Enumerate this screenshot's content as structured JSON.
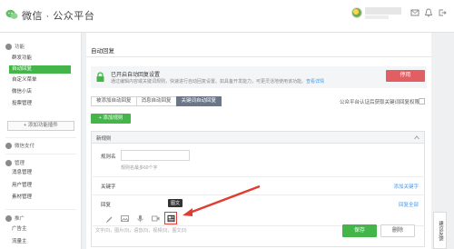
{
  "header": {
    "logo_text": "微信 · 公众平台",
    "user_name": "",
    "icons": [
      "message-icon",
      "bell-icon",
      "logout-icon"
    ]
  },
  "sidebar": {
    "groups": [
      {
        "label": "功能",
        "icon": "function-icon"
      },
      {
        "label": "微信支付",
        "icon": "wechat-pay-icon"
      },
      {
        "label": "管理",
        "icon": "manage-icon"
      },
      {
        "label": "推广",
        "icon": "promote-icon"
      }
    ],
    "items": [
      {
        "label": "群发功能",
        "active": false
      },
      {
        "label": "自动回复",
        "active": true
      },
      {
        "label": "自定义菜单",
        "active": false
      },
      {
        "label": "微信小店",
        "active": false
      },
      {
        "label": "投票管理",
        "active": false
      },
      {
        "label": "消息管理",
        "active": false
      },
      {
        "label": "用户管理",
        "active": false
      },
      {
        "label": "素材管理",
        "active": false
      },
      {
        "label": "广告主",
        "active": false
      },
      {
        "label": "流量主",
        "active": false
      }
    ],
    "add_plugin": "+ 添加功能插件"
  },
  "main": {
    "title": "自动回复",
    "notice": {
      "title": "已开启自动回复设置",
      "desc": "通过编辑内容或关键词规则，快速进行自动回复设置。如具备开发能力，可更灵活地使用该功能。",
      "link": "查看详情"
    },
    "disable_button": "停用",
    "tabs": [
      {
        "label": "被添加自动回复",
        "selected": false
      },
      {
        "label": "消息自动回复",
        "selected": false
      },
      {
        "label": "关键词自动回复",
        "selected": true
      }
    ],
    "kw_check_label": "公众平台认证后获取关键词回复权限",
    "add_rule_button": "+ 添加规则",
    "rule": {
      "header": "新规则",
      "name_label": "规则名",
      "name_hint": "规则名最多60个字",
      "keyword_label": "关键字",
      "add_keyword": "添加关键字",
      "reply_label": "回复",
      "reply_all": "回复全部",
      "toolbar": [
        "text-icon",
        "image-icon",
        "voice-icon",
        "video-icon",
        "news-icon"
      ],
      "tooltip": "图文",
      "counter": "文字(0)，图片(0)，语音(0)，视频(0)，图文(0)"
    },
    "save_button": "保存",
    "delete_button": "删除"
  },
  "feedback": "建议反馈",
  "colors": {
    "primary": "#44b549",
    "danger": "#e15f63",
    "tab_selected": "#6c7689",
    "link": "#459ae9",
    "annotation": "#e03c31"
  }
}
